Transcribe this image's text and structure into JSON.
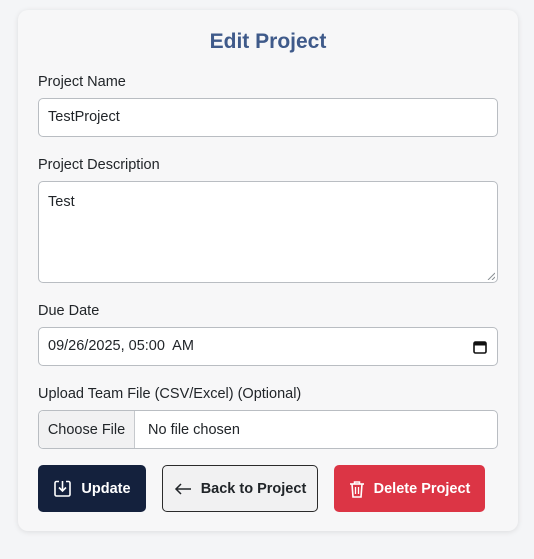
{
  "form": {
    "title": "Edit Project",
    "project_name": {
      "label": "Project Name",
      "value": "TestProject"
    },
    "project_description": {
      "label": "Project Description",
      "value": "Test"
    },
    "due_date": {
      "label": "Due Date",
      "value": "09/26/2025, 05:00  AM"
    },
    "upload": {
      "label": "Upload Team File (CSV/Excel) (Optional)",
      "button_label": "Choose File",
      "status": "No file chosen"
    },
    "buttons": {
      "update": "Update",
      "back": "Back to Project",
      "delete": "Delete Project"
    }
  },
  "icons": {
    "update": "save-download-icon",
    "back": "arrow-left-icon",
    "delete": "trash-icon",
    "calendar": "calendar-icon"
  },
  "colors": {
    "title": "#3f5a8a",
    "update_button": "#14213d",
    "delete_button": "#dc3545",
    "page_background": "#f4f5f7"
  }
}
